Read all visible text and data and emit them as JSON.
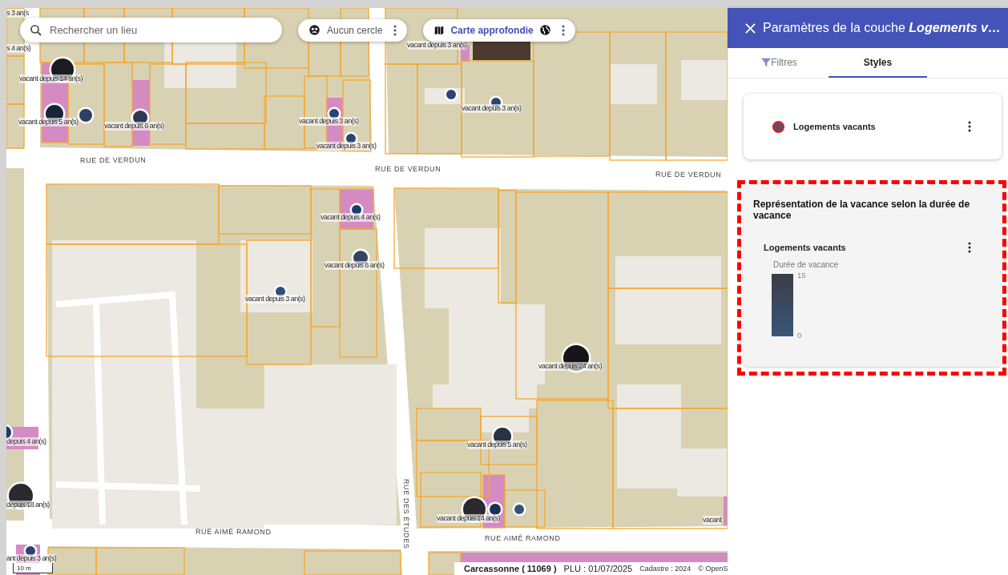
{
  "search": {
    "placeholder": "Rechercher un lieu"
  },
  "map_controls": [
    {
      "kind": "circle",
      "label": "Aucun cercle"
    },
    {
      "kind": "basemap",
      "label": "Carte approfondie"
    }
  ],
  "markers": [
    {
      "label": "s 3 an(s"
    },
    {
      "label": "s 4 an(s)"
    },
    {
      "label": "vacant depuis 14 an(s)",
      "color": "#1b1b22"
    },
    {
      "label": "vacant depuis 5 an(s)",
      "color": "#1a2438"
    },
    {
      "color": "#2e4060"
    },
    {
      "label": "vacant depuis 6 an(s)",
      "color": "#2f3656"
    },
    {
      "label": "vacant depuis 3 an(s)",
      "color": "#2b4470"
    },
    {
      "label": "vacant depuis 3 an(s)",
      "color": "#2b4470"
    },
    {
      "label": "vacant depuis 3 an(s)"
    },
    {
      "color": "#2b4470"
    },
    {
      "label": "vacant depuis 3 an(s)",
      "color": "#2b4470"
    },
    {
      "label": "vacant depuis 4 an(s)",
      "color": "#1e3a68"
    },
    {
      "label": "vacant depuis 6 an(s)",
      "color": "#34455f"
    },
    {
      "label": "vacant depuis 3 an(s)",
      "color": "#2f4c7a"
    },
    {
      "label": "vacant depuis 24 an(s)",
      "color": "#15151a"
    },
    {
      "label": "vacant depuis 5 an(s)",
      "color": "#283345"
    },
    {
      "label": "depuis 4 an(s)",
      "color": "#1e3a68"
    },
    {
      "label": "depuis 18 an(s)",
      "color": "#2a2a2e"
    },
    {
      "label": "vacant depuis 14 an(s)",
      "color": "#2a2a2e"
    },
    {
      "color": "#1c3058"
    },
    {
      "color": "#355080"
    },
    {
      "label": "vacant"
    },
    {
      "label": "ant depuis 3 an(s)",
      "color": "#2b4470"
    }
  ],
  "streets": [
    {
      "name": "RUE DE VERDUN",
      "kind": "horizontal"
    },
    {
      "name": "RUE DE VERDUN",
      "kind": "horizontal"
    },
    {
      "name": "RUE DE VERDUN",
      "kind": "horizontal"
    },
    {
      "name": "RUE DES ÉTUDES",
      "kind": "vertical"
    },
    {
      "name": "RUE AIMÉ RAMOND",
      "kind": "horizontal"
    },
    {
      "name": "RUE AIMÉ RAMOND",
      "kind": "horizontal"
    }
  ],
  "scale": "10 m",
  "attribution": {
    "commune": "Carcassonne ( 11069 )",
    "plu": "PLU : 01/07/2025",
    "cadastre": "Cadastre : 2024",
    "copyright": "© OpenS"
  },
  "panel": {
    "title": "Paramètres de la couche **Logements v…**",
    "tabs": [
      {
        "label": "Filtres",
        "kind": "filter",
        "selected": false
      },
      {
        "label": "Styles",
        "kind": "plain",
        "selected": true
      }
    ],
    "layer": {
      "name": "Logements vacants"
    },
    "style_card": {
      "highlighted": true,
      "title": "Représentation de la vacance selon la durée de vacance",
      "layer": "Logements vacants",
      "legend": {
        "title": "Durée de vacance",
        "max": "15",
        "min": "0"
      }
    }
  }
}
